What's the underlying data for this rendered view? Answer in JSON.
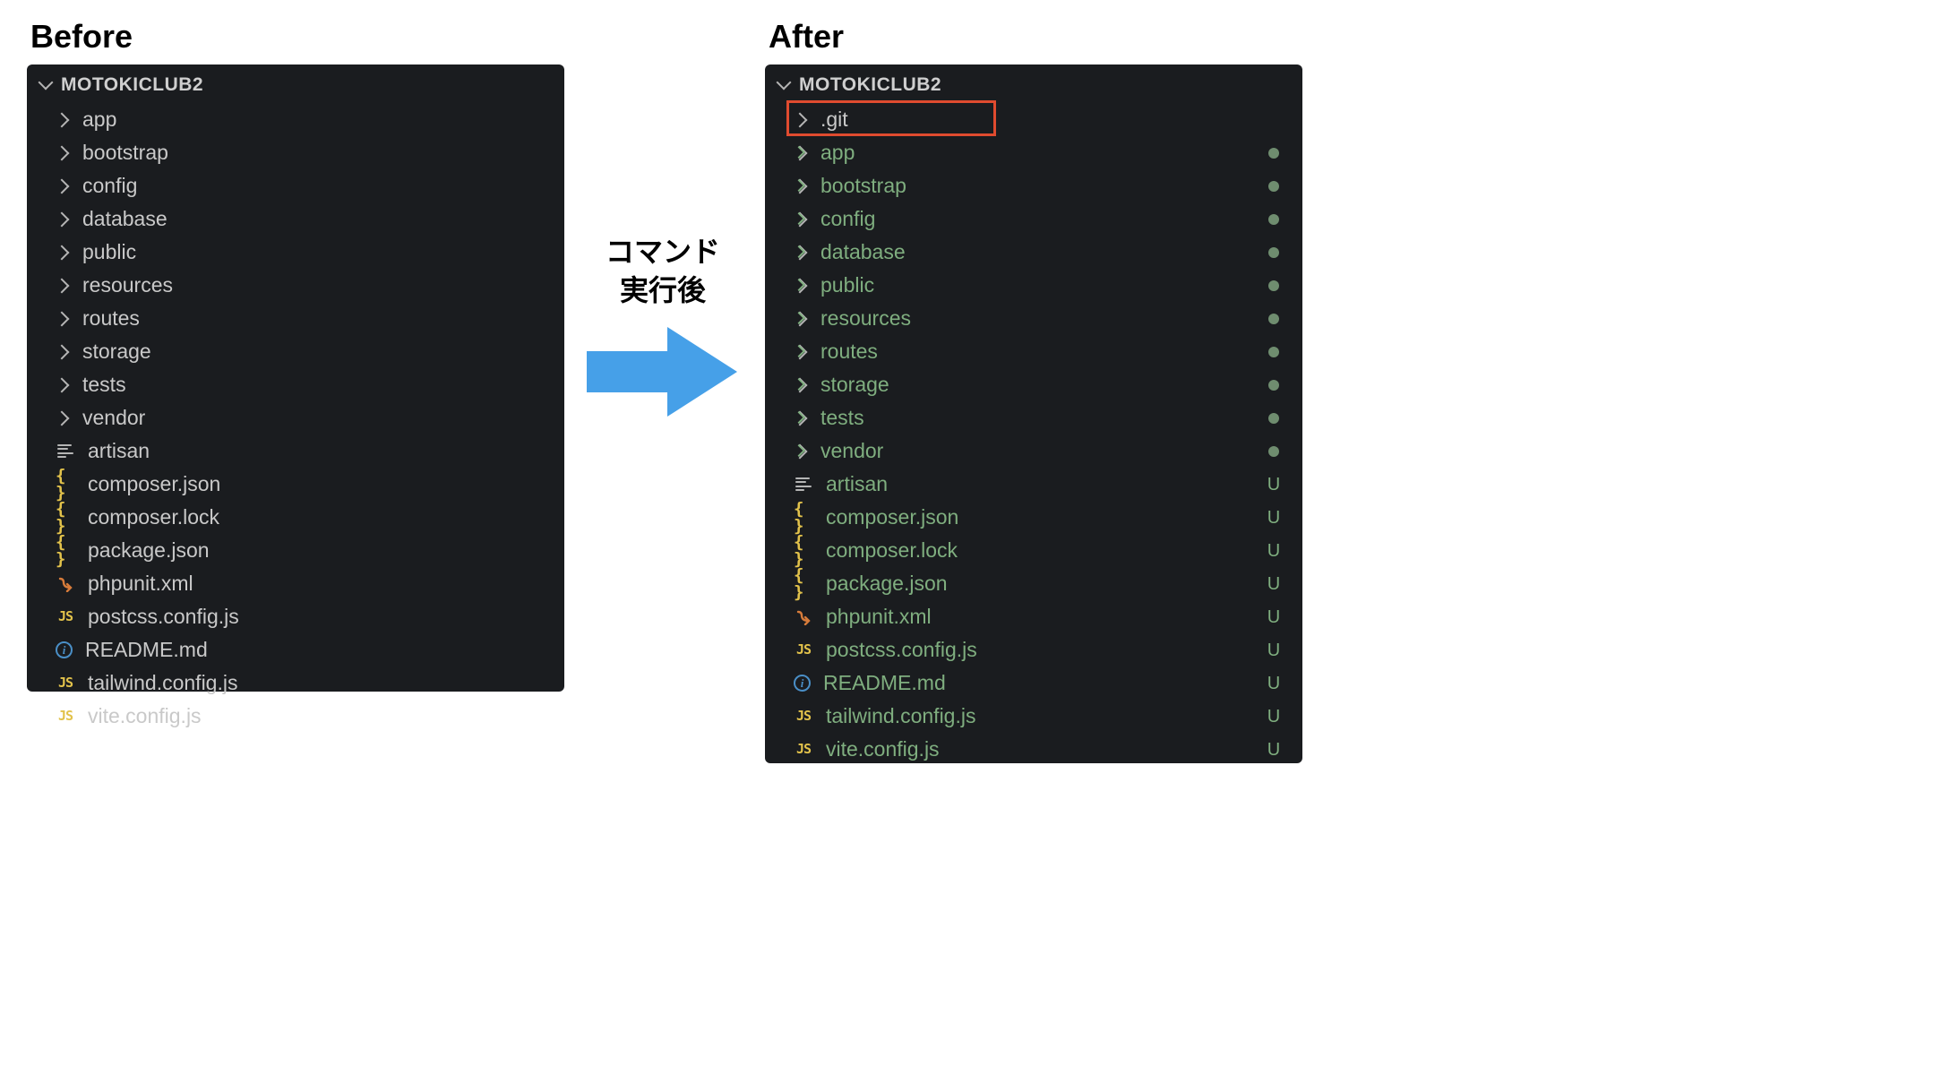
{
  "titles": {
    "before": "Before",
    "after": "After"
  },
  "caption": {
    "line1": "コマンド",
    "line2": "実行後"
  },
  "project_name": "MOTOKICLUB2",
  "before": {
    "folders": [
      {
        "label": "app"
      },
      {
        "label": "bootstrap"
      },
      {
        "label": "config"
      },
      {
        "label": "database"
      },
      {
        "label": "public"
      },
      {
        "label": "resources"
      },
      {
        "label": "routes"
      },
      {
        "label": "storage"
      },
      {
        "label": "tests"
      },
      {
        "label": "vendor"
      }
    ],
    "files": [
      {
        "label": "artisan",
        "icon": "lines"
      },
      {
        "label": "composer.json",
        "icon": "json"
      },
      {
        "label": "composer.lock",
        "icon": "json"
      },
      {
        "label": "package.json",
        "icon": "json"
      },
      {
        "label": "phpunit.xml",
        "icon": "xml"
      },
      {
        "label": "postcss.config.js",
        "icon": "js"
      },
      {
        "label": "README.md",
        "icon": "info"
      },
      {
        "label": "tailwind.config.js",
        "icon": "js"
      },
      {
        "label": "vite.config.js",
        "icon": "js"
      }
    ]
  },
  "after": {
    "git_folder": {
      "label": ".git"
    },
    "folders": [
      {
        "label": "app",
        "status": "dot"
      },
      {
        "label": "bootstrap",
        "status": "dot"
      },
      {
        "label": "config",
        "status": "dot"
      },
      {
        "label": "database",
        "status": "dot"
      },
      {
        "label": "public",
        "status": "dot"
      },
      {
        "label": "resources",
        "status": "dot"
      },
      {
        "label": "routes",
        "status": "dot"
      },
      {
        "label": "storage",
        "status": "dot"
      },
      {
        "label": "tests",
        "status": "dot"
      },
      {
        "label": "vendor",
        "status": "dot"
      }
    ],
    "files": [
      {
        "label": "artisan",
        "icon": "lines",
        "status": "U"
      },
      {
        "label": "composer.json",
        "icon": "json",
        "status": "U"
      },
      {
        "label": "composer.lock",
        "icon": "json",
        "status": "U"
      },
      {
        "label": "package.json",
        "icon": "json",
        "status": "U"
      },
      {
        "label": "phpunit.xml",
        "icon": "xml",
        "status": "U"
      },
      {
        "label": "postcss.config.js",
        "icon": "js",
        "status": "U"
      },
      {
        "label": "README.md",
        "icon": "info",
        "status": "U"
      },
      {
        "label": "tailwind.config.js",
        "icon": "js",
        "status": "U"
      },
      {
        "label": "vite.config.js",
        "icon": "js",
        "status": "U"
      }
    ]
  },
  "colors": {
    "panel_bg": "#1a1c1f",
    "text_default": "#c9c9c9",
    "git_green": "#7fae7f",
    "highlight": "#e04b2f",
    "arrow": "#46a0e8"
  }
}
